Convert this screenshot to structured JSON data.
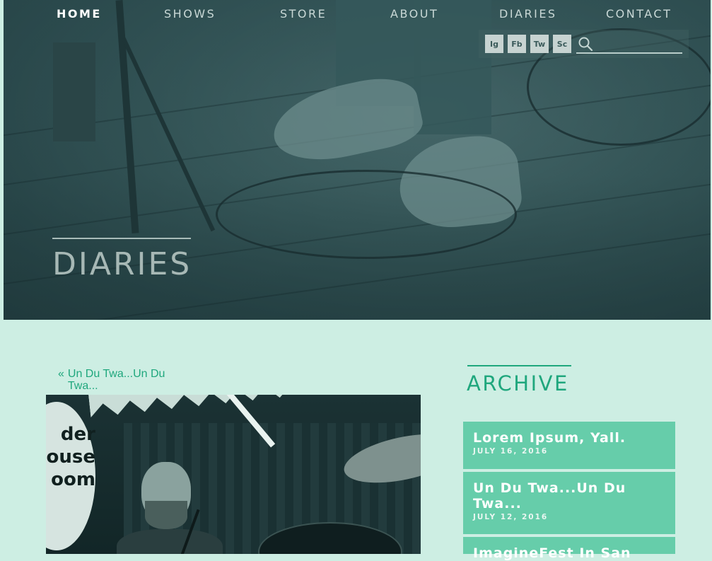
{
  "nav": {
    "items": [
      {
        "label": "HOME",
        "active": true
      },
      {
        "label": "SHOWS",
        "active": false
      },
      {
        "label": "STORE",
        "active": false
      },
      {
        "label": "ABOUT",
        "active": false
      },
      {
        "label": "DIARIES",
        "active": false
      },
      {
        "label": "CONTACT",
        "active": false
      }
    ]
  },
  "social": {
    "items": [
      {
        "label": "Ig",
        "icon": "instagram-icon"
      },
      {
        "label": "Fb",
        "icon": "facebook-icon"
      },
      {
        "label": "Tw",
        "icon": "twitter-icon"
      },
      {
        "label": "Sc",
        "icon": "soundcloud-icon"
      }
    ],
    "search": {
      "value": "",
      "placeholder": "",
      "icon": "search-icon"
    }
  },
  "hero": {
    "title": "DIARIES"
  },
  "post": {
    "prev_arrow": "«",
    "prev_label": "Un Du Twa...Un Du Twa...",
    "image_text": "der ouse oom"
  },
  "archive": {
    "title": "ARCHIVE",
    "items": [
      {
        "title": "Lorem Ipsum, Yall.",
        "date": "JULY 16, 2016"
      },
      {
        "title": "Un Du Twa...Un Du Twa...",
        "date": "JULY 12, 2016"
      },
      {
        "title": "ImagineFest In San",
        "date": ""
      }
    ]
  },
  "colors": {
    "page_bg": "#cdeee3",
    "accent": "#1fa77d",
    "archive_item_bg": "#66cdaa",
    "hero_tint": "#2f5557"
  }
}
